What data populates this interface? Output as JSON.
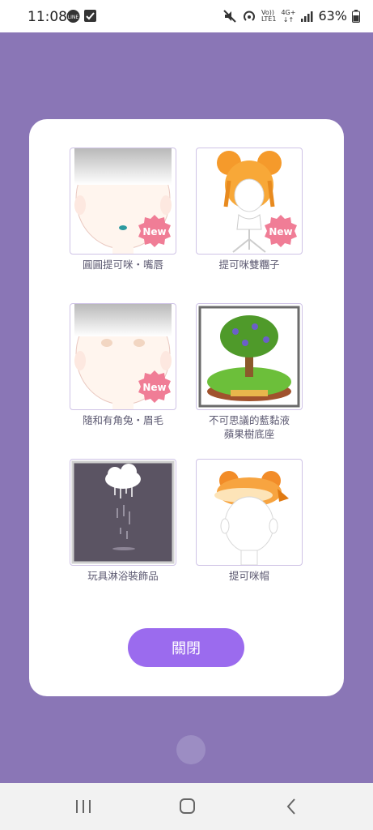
{
  "status_bar": {
    "time": "11:08",
    "network_label_top": "Vo))",
    "network_label_bottom": "LTE1",
    "network_type": "4G+",
    "battery": "63%",
    "icons": [
      "line-icon",
      "checkbox-icon",
      "mute-icon",
      "hotspot-icon",
      "signal-icon",
      "battery-icon"
    ]
  },
  "dialog": {
    "items": [
      {
        "label": "圓圓提可咪・嘴唇",
        "new": "New",
        "icon": "face-lips-icon"
      },
      {
        "label": "提可咪雙糰子",
        "new": "New",
        "icon": "double-bun-hair-icon"
      },
      {
        "label": "隨和有角兔・眉毛",
        "new": "New",
        "icon": "face-eyebrows-icon"
      },
      {
        "label": "不可思議的藍黏液\n蘋果樹底座",
        "icon": "apple-tree-base-icon"
      },
      {
        "label": "玩具淋浴裝飾品",
        "icon": "rain-cloud-icon"
      },
      {
        "label": "提可咪帽",
        "icon": "orange-hat-icon"
      }
    ],
    "close_label": "關閉"
  },
  "colors": {
    "overlay": "#8a76b6",
    "accent": "#9b6bee",
    "badge": "#f07d96"
  }
}
